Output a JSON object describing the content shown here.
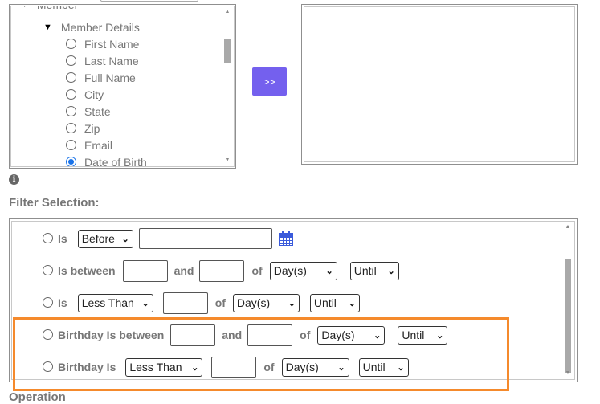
{
  "tree": {
    "parent_label": "Member",
    "group_label": "Member Details",
    "items": [
      {
        "label": "First Name",
        "selected": false
      },
      {
        "label": "Last Name",
        "selected": false
      },
      {
        "label": "Full Name",
        "selected": false
      },
      {
        "label": "City",
        "selected": false
      },
      {
        "label": "State",
        "selected": false
      },
      {
        "label": "Zip",
        "selected": false
      },
      {
        "label": "Email",
        "selected": false
      },
      {
        "label": "Date of Birth",
        "selected": true
      }
    ]
  },
  "move_button_label": ">>",
  "filter": {
    "heading": "Filter Selection:",
    "rows": [
      {
        "label": "Is",
        "operator": "Before",
        "checked": false
      },
      {
        "label": "Is between",
        "and": "and",
        "of": "of",
        "unit": "Day(s)",
        "until": "Until",
        "checked": false
      },
      {
        "label": "Is",
        "operator": "Less Than",
        "of": "of",
        "unit": "Day(s)",
        "until": "Until",
        "checked": false
      },
      {
        "label": "Birthday Is between",
        "and": "and",
        "of": "of",
        "unit": "Day(s)",
        "until": "Until",
        "checked": false
      },
      {
        "label": "Birthday Is",
        "operator": "Less Than",
        "of": "of",
        "unit": "Day(s)",
        "until": "Until",
        "checked": false
      }
    ]
  },
  "next_section_label": "Operation",
  "colors": {
    "accent": "#7460ee",
    "highlight": "#f58a2c",
    "radio_selected": "#1a73e8"
  }
}
